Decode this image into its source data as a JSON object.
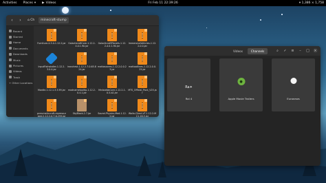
{
  "topbar": {
    "activities": "Activities",
    "places": "Places",
    "videos": "Videos",
    "clock": "Fri Feb 11 22:39:26",
    "status": "▾ 1,386 × 1,758"
  },
  "files": {
    "location": "minecraft-stump",
    "breadcrumb_home": "⌂ Ch",
    "sidebar": [
      {
        "label": "Recent"
      },
      {
        "label": "Starred"
      },
      {
        "label": "Home"
      },
      {
        "label": "Documents"
      },
      {
        "label": "Downloads"
      },
      {
        "label": "Music"
      },
      {
        "label": "Pictures"
      },
      {
        "label": "Videos"
      },
      {
        "label": "Trash"
      },
      {
        "label": "+ Other Locations"
      }
    ],
    "items": [
      {
        "name": "Furniture-4.3.0-1.12.2.jar",
        "kind": "zip"
      },
      {
        "name": "GalacticraftCore-1.12.2-4.0.1.90.jar",
        "kind": "zip"
      },
      {
        "name": "GalacticraftPlanets-1.12.2-4.0.1.90.jar",
        "kind": "zip"
      },
      {
        "name": "ImmersiveVehicles-1.12.2-0.0.jar",
        "kind": "zip"
      },
      {
        "name": "InputFixInstaller-1.12.2-3.0.4.jar",
        "kind": "logo"
      },
      {
        "name": "ironchest-1.12.2-7.0.65.824.jar",
        "kind": "zip"
      },
      {
        "name": "mattoscores-1.12.2-0.0.23.jar",
        "kind": "zip"
      },
      {
        "name": "mattoatlines-1.12.2-0.0.25.jar",
        "kind": "zip"
      },
      {
        "name": "MantIe-1.12-1.3.3.99.jar",
        "kind": "zip"
      },
      {
        "name": "modnametooltip-1.12.2-0.4.1.jar",
        "kind": "zip"
      },
      {
        "name": "MrcbxebbCore-1.12.2-1.0.5-b2.jar",
        "kind": "zip"
      },
      {
        "name": "MTS_Official_Pack_V25.jar",
        "kind": "zip"
      },
      {
        "name": "pneumaticcraft-repressurized-1.12.2-0.7.6.259.jar",
        "kind": "zip"
      },
      {
        "name": "SkyBlock-2.7.jar",
        "kind": "skin"
      },
      {
        "name": "Sound-Physics-Mod-1.12.2.jar",
        "kind": "zip"
      },
      {
        "name": "Waila-Client-VT-1.12.2-MC1.16.5.jar",
        "kind": "zip"
      }
    ]
  },
  "video": {
    "tabs": [
      "Videos",
      "Channels"
    ],
    "active_tab": "Channels",
    "channels": [
      {
        "name": "Rai 4",
        "logo": "logo-ra"
      },
      {
        "name": "Apple Movie Trailers",
        "logo": "logo-am"
      },
      {
        "name": "Euronews",
        "logo": "logo-eu"
      }
    ]
  }
}
